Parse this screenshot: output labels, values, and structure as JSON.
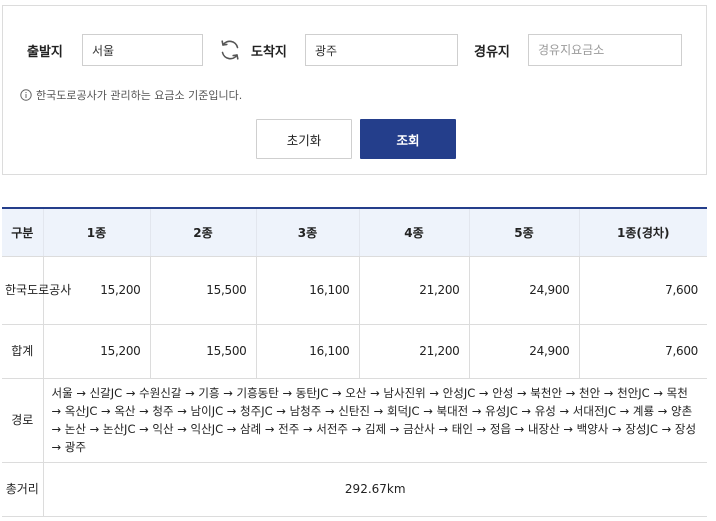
{
  "search": {
    "departure_label": "출발지",
    "departure_value": "서울",
    "arrival_label": "도착지",
    "arrival_value": "광주",
    "via_label": "경유지",
    "via_placeholder": "경유지요금소",
    "notice": "한국도로공사가 관리하는 요금소 기준입니다.",
    "reset_label": "초기화",
    "search_label": "조회"
  },
  "colors": {
    "accent": "#243e8b",
    "header_bg": "#eef3fb",
    "border": "#dcdcdc"
  },
  "icons": {
    "swap": "refresh-arrows-icon",
    "info": "info-circle-icon"
  },
  "table": {
    "headers": [
      "구분",
      "1종",
      "2종",
      "3종",
      "4종",
      "5종",
      "1종(경차)"
    ],
    "rows": [
      {
        "label": "한국도로공사",
        "values": [
          "15,200",
          "15,500",
          "16,100",
          "21,200",
          "24,900",
          "7,600"
        ]
      },
      {
        "label": "합계",
        "values": [
          "15,200",
          "15,500",
          "16,100",
          "21,200",
          "24,900",
          "7,600"
        ]
      }
    ],
    "route_label": "경로",
    "route_value": "서울 → 신갈JC → 수원신갈 → 기흥 → 기흥동탄 → 동탄JC → 오산 → 남사진위 → 안성JC → 안성 → 북천안 → 천안 → 천안JC → 목천 → 옥산JC → 옥산 → 청주 → 남이JC → 청주JC → 남청주 → 신탄진 → 회덕JC → 북대전 → 유성JC → 유성 → 서대전JC → 계룡 → 양촌 → 논산 → 논산JC → 익산 → 익산JC → 삼례 → 전주 → 서전주 → 김제 → 금산사 → 태인 → 정읍 → 내장산 → 백양사 → 장성JC → 장성 → 광주",
    "distance_label": "총거리",
    "distance_value": "292.67km"
  }
}
